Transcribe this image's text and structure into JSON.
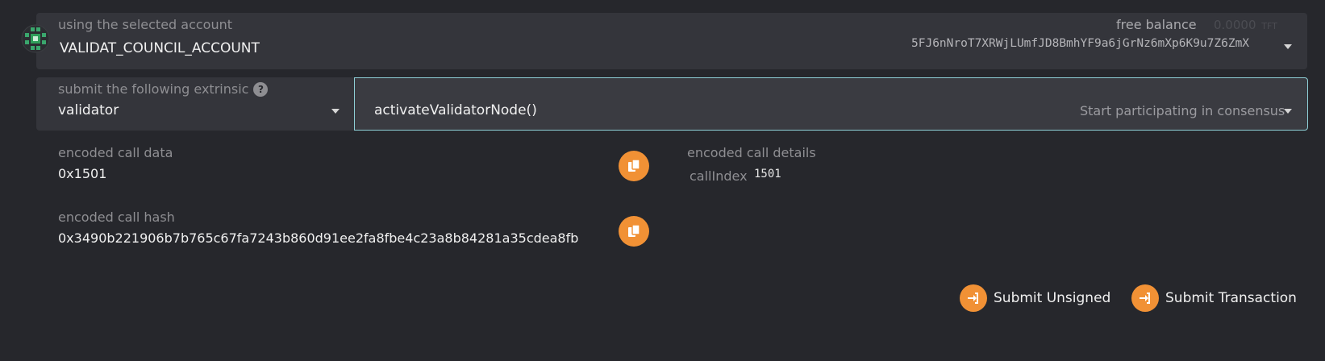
{
  "account": {
    "label": "using the selected account",
    "name": "VALIDAT_COUNCIL_ACCOUNT",
    "balance_label": "free balance",
    "balance_value": "0.0000",
    "balance_unit": "TFT",
    "address": "5FJ6nNroT7XRWjLUmfJD8BmhYF9a6jGrNz6mXp6K9u7Z6ZmX"
  },
  "extrinsic": {
    "label": "submit the following extrinsic",
    "help_icon": "?",
    "section": "validator",
    "method": "activateValidatorNode()",
    "method_doc": "Start participating in consensus"
  },
  "encoded": {
    "call_data_label": "encoded call data",
    "call_data": "0x1501",
    "details_label": "encoded call details",
    "call_index_label": "callIndex",
    "call_index": "1501",
    "hash_label": "encoded call hash",
    "hash": "0x3490b221906b7b765c67fa7243b860d91ee2fa8fbe4c23a8b84281a35cdea8fb"
  },
  "actions": {
    "submit_unsigned": "Submit Unsigned",
    "submit_transaction": "Submit Transaction"
  },
  "colors": {
    "accent": "#f19135",
    "background": "#26272c",
    "panel": "#34353b",
    "identicon": "#2f9e5a"
  }
}
